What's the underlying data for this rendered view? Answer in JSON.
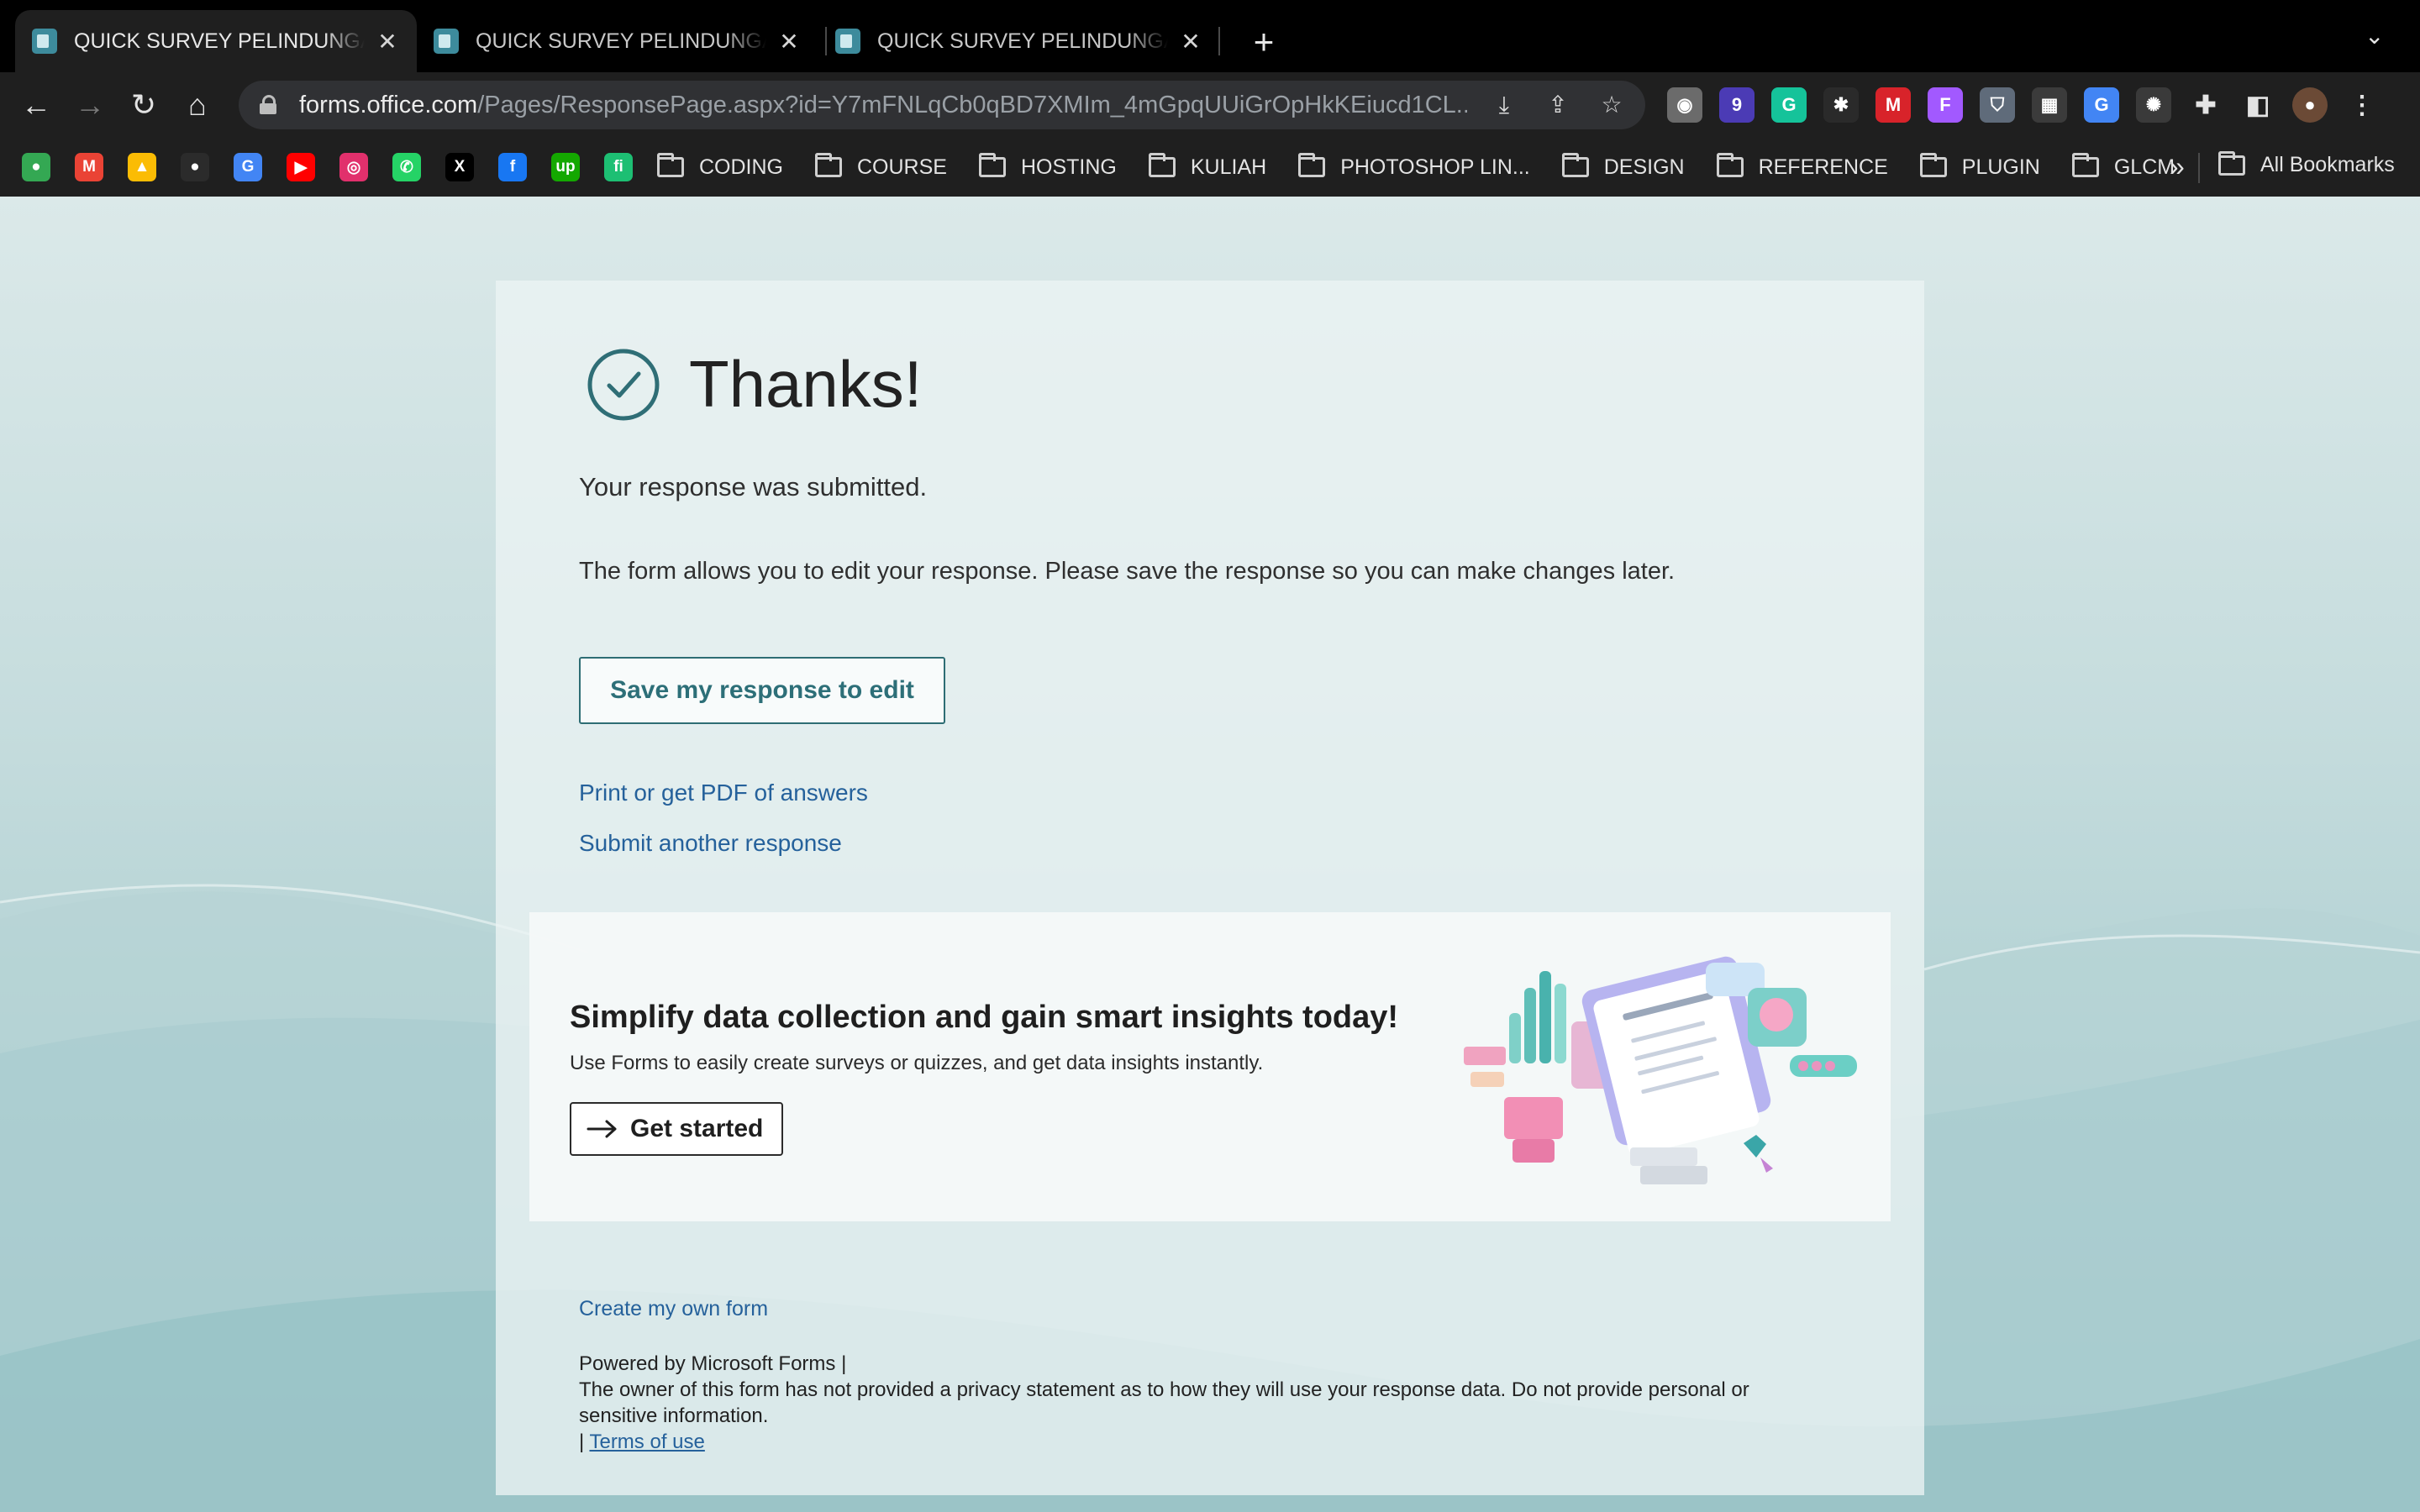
{
  "browser": {
    "tabs": [
      {
        "title": "QUICK SURVEY PELINDUNGAN",
        "active": true
      },
      {
        "title": "QUICK SURVEY PELINDUNGAN",
        "active": false
      },
      {
        "title": "QUICK SURVEY PELINDUNGAN",
        "active": false
      }
    ],
    "new_tab": "+",
    "tab_menu": "⌄",
    "nav": {
      "back": "←",
      "forward": "→",
      "reload": "↻",
      "home": "⌂"
    },
    "url": {
      "host": "forms.office.com",
      "path": "/Pages/ResponsePage.aspx?id=Y7mFNLqCb0qBD7XMIm_4mGpqUUiGrOpHkKEiucd1CL..."
    },
    "omnibox_icons": [
      "⤓",
      "⇪",
      "☆"
    ],
    "extensions": [
      {
        "name": "owl-extension-icon",
        "glyph": "◉",
        "color": "#6b6b6b"
      },
      {
        "name": "purple-extension-icon",
        "glyph": "9",
        "color": "#4b3bb5"
      },
      {
        "name": "grammarly-icon",
        "glyph": "G",
        "color": "#15c39a"
      },
      {
        "name": "paw-extension-icon",
        "glyph": "✱",
        "color": "#2a2a2a"
      },
      {
        "name": "mendeley-icon",
        "glyph": "M",
        "color": "#d8232a"
      },
      {
        "name": "figma-extension-icon",
        "glyph": "F",
        "color": "#a259ff"
      },
      {
        "name": "shield-extension-icon",
        "glyph": "⛉",
        "color": "#5f6b7a"
      },
      {
        "name": "qr-code-icon",
        "glyph": "▦",
        "color": "#3b3b3b"
      },
      {
        "name": "google-translate-icon",
        "glyph": "G",
        "color": "#4285f4"
      },
      {
        "name": "bug-extension-icon",
        "glyph": "✺",
        "color": "#3a3a3a"
      },
      {
        "name": "puzzle-extensions-icon",
        "glyph": "✚",
        "color": "#1f1f1f"
      },
      {
        "name": "side-panel-icon",
        "glyph": "◧",
        "color": "#1f1f1f"
      },
      {
        "name": "profile-avatar",
        "glyph": "●",
        "color": "#6b4a36"
      },
      {
        "name": "kebab-menu-icon",
        "glyph": "⋮",
        "color": "#1f1f1f"
      }
    ],
    "bookmark_icons": [
      {
        "name": "google-maps-icon",
        "glyph": "●",
        "color": "#34a853"
      },
      {
        "name": "gmail-icon",
        "glyph": "M",
        "color": "#ea4335"
      },
      {
        "name": "google-drive-icon",
        "glyph": "▲",
        "color": "#fbbc04"
      },
      {
        "name": "github-icon",
        "glyph": "●",
        "color": "#2b2b2b"
      },
      {
        "name": "google-translate-bookmark-icon",
        "glyph": "G",
        "color": "#4285f4"
      },
      {
        "name": "youtube-icon",
        "glyph": "▶",
        "color": "#ff0000"
      },
      {
        "name": "instagram-icon",
        "glyph": "◎",
        "color": "#e1306c"
      },
      {
        "name": "whatsapp-icon",
        "glyph": "✆",
        "color": "#25d366"
      },
      {
        "name": "x-twitter-icon",
        "glyph": "X",
        "color": "#000000"
      },
      {
        "name": "facebook-icon",
        "glyph": "f",
        "color": "#1877f2"
      },
      {
        "name": "upwork-icon",
        "glyph": "up",
        "color": "#14a800"
      },
      {
        "name": "fiverr-icon",
        "glyph": "fi",
        "color": "#1dbf73"
      }
    ],
    "bookmark_folders": [
      "CODING",
      "COURSE",
      "HOSTING",
      "KULIAH",
      "PHOTOSHOP LIN...",
      "DESIGN",
      "REFERENCE",
      "PLUGIN",
      "GLCM"
    ],
    "bookmarks_more": "»",
    "all_bookmarks": "All Bookmarks"
  },
  "page": {
    "thanks_title": "Thanks!",
    "submitted_text": "Your response was submitted.",
    "edit_note": "The form allows you to edit your response. Please save the response so you can make changes later.",
    "save_button": "Save my response to edit",
    "print_link": "Print or get PDF of answers",
    "another_link": "Submit another response",
    "promo": {
      "title": "Simplify data collection and gain smart insights today!",
      "description": "Use Forms to easily create surveys or quizzes, and get data insights instantly.",
      "button": "Get started"
    },
    "create_link": "Create my own form",
    "footer": {
      "powered_by": "Powered by Microsoft Forms |",
      "privacy_note": "The owner of this form has not provided a privacy statement as to how they will use your response data. Do not provide personal or sensitive information.",
      "separator": "|",
      "terms": "Terms of use"
    }
  },
  "colors": {
    "accent": "#2d6f78",
    "link": "#25619b",
    "check": "#2f6e76"
  }
}
